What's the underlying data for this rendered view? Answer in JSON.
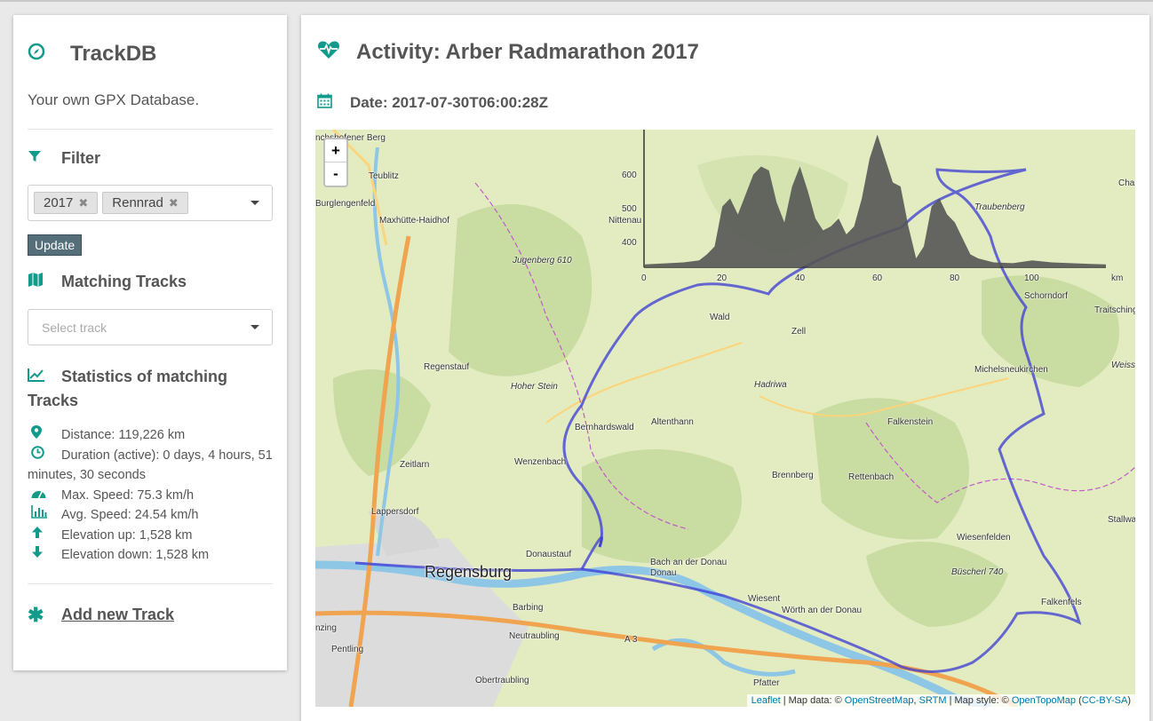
{
  "app": {
    "name": "TrackDB",
    "tagline": "Your own GPX Database."
  },
  "filter": {
    "title": "Filter",
    "tags": [
      "2017",
      "Rennrad"
    ],
    "update_label": "Update"
  },
  "matching": {
    "title": "Matching Tracks",
    "placeholder": "Select track"
  },
  "stats": {
    "title": "Statistics of matching Tracks",
    "items": [
      {
        "icon": "map-marker-icon",
        "text": "Distance: 119,226 km"
      },
      {
        "icon": "clock-icon",
        "text": "Duration (active): 0 days, 4 hours, 51 minutes, 30 seconds"
      },
      {
        "icon": "tachometer-icon",
        "text": "Max. Speed: 75.3 km/h"
      },
      {
        "icon": "bar-chart-icon",
        "text": "Avg. Speed: 24.54 km/h"
      },
      {
        "icon": "arrow-up-icon",
        "text": "Elevation up: 1,528 km"
      },
      {
        "icon": "arrow-down-icon",
        "text": "Elevation down: 1,528 km"
      }
    ]
  },
  "add_track": "Add new Track",
  "activity": {
    "title": "Activity: Arber Radmarathon 2017",
    "date": "Date: 2017-07-30T06:00:28Z"
  },
  "map": {
    "zoom_in": "+",
    "zoom_out": "-",
    "attribution": {
      "leaflet": "Leaflet",
      "sep1": " | Map data: © ",
      "osm": "OpenStreetMap",
      "comma": ", ",
      "srtm": "SRTM",
      "sep2": " | Map style: © ",
      "otm": "OpenTopoMap",
      "open": " (",
      "license": "CC-BY-SA",
      "close": ")"
    },
    "places": [
      "Regensburg",
      "Lappersdorf",
      "Zeitlarn",
      "Regenstauf",
      "Maxhütte-Haidhof",
      "Teublitz",
      "Burglengenfeld",
      "Wenzenbach",
      "Bernhardswald",
      "Altenthann",
      "Wald",
      "Zell",
      "Falkenstein",
      "Michelsneukirchen",
      "Schorndorf",
      "Brennberg",
      "Rettenbach",
      "Wiesenfelden",
      "Donaustauf",
      "Bach an der Donau",
      "Wiesent",
      "Wörth an der Donau",
      "Barbing",
      "Neutraubling",
      "Obertraubling",
      "Pentling",
      "Pfatter",
      "Falkenfels",
      "Traitsching",
      "Stallwang",
      "Nittenau",
      "Hoher Stein",
      "Hadriwa",
      "Büscherl 740",
      "Jugenberg 610",
      "Traubenberg",
      "A 3",
      "Weiss",
      "Cha",
      "nchsbofener Berg",
      "nzing"
    ],
    "elevation": {
      "y_ticks": [
        "600",
        "500",
        "400"
      ],
      "x_ticks": [
        "0",
        "20",
        "40",
        "60",
        "80",
        "100"
      ],
      "x_unit": "km"
    }
  },
  "chart_data": {
    "type": "area",
    "title": "",
    "xlabel": "km",
    "ylabel": "",
    "ylim": [
      330,
      650
    ],
    "xlim": [
      0,
      119
    ],
    "x": [
      0,
      10,
      14,
      16,
      18,
      20,
      22,
      24,
      26,
      28,
      30,
      32,
      34,
      36,
      38,
      40,
      42,
      44,
      46,
      48,
      50,
      52,
      54,
      56,
      58,
      60,
      62,
      64,
      66,
      68,
      70,
      72,
      74,
      76,
      78,
      80,
      82,
      84,
      86,
      88,
      90,
      95,
      100,
      105,
      110,
      115,
      119
    ],
    "series": [
      {
        "values": [
          335,
          340,
          345,
          360,
          380,
          480,
          500,
          460,
          510,
          560,
          580,
          570,
          490,
          440,
          530,
          580,
          520,
          450,
          420,
          430,
          450,
          410,
          430,
          500,
          600,
          660,
          600,
          540,
          530,
          430,
          350,
          380,
          480,
          500,
          460,
          440,
          400,
          360,
          350,
          345,
          340,
          338,
          345,
          340,
          338,
          336,
          335
        ]
      }
    ]
  }
}
